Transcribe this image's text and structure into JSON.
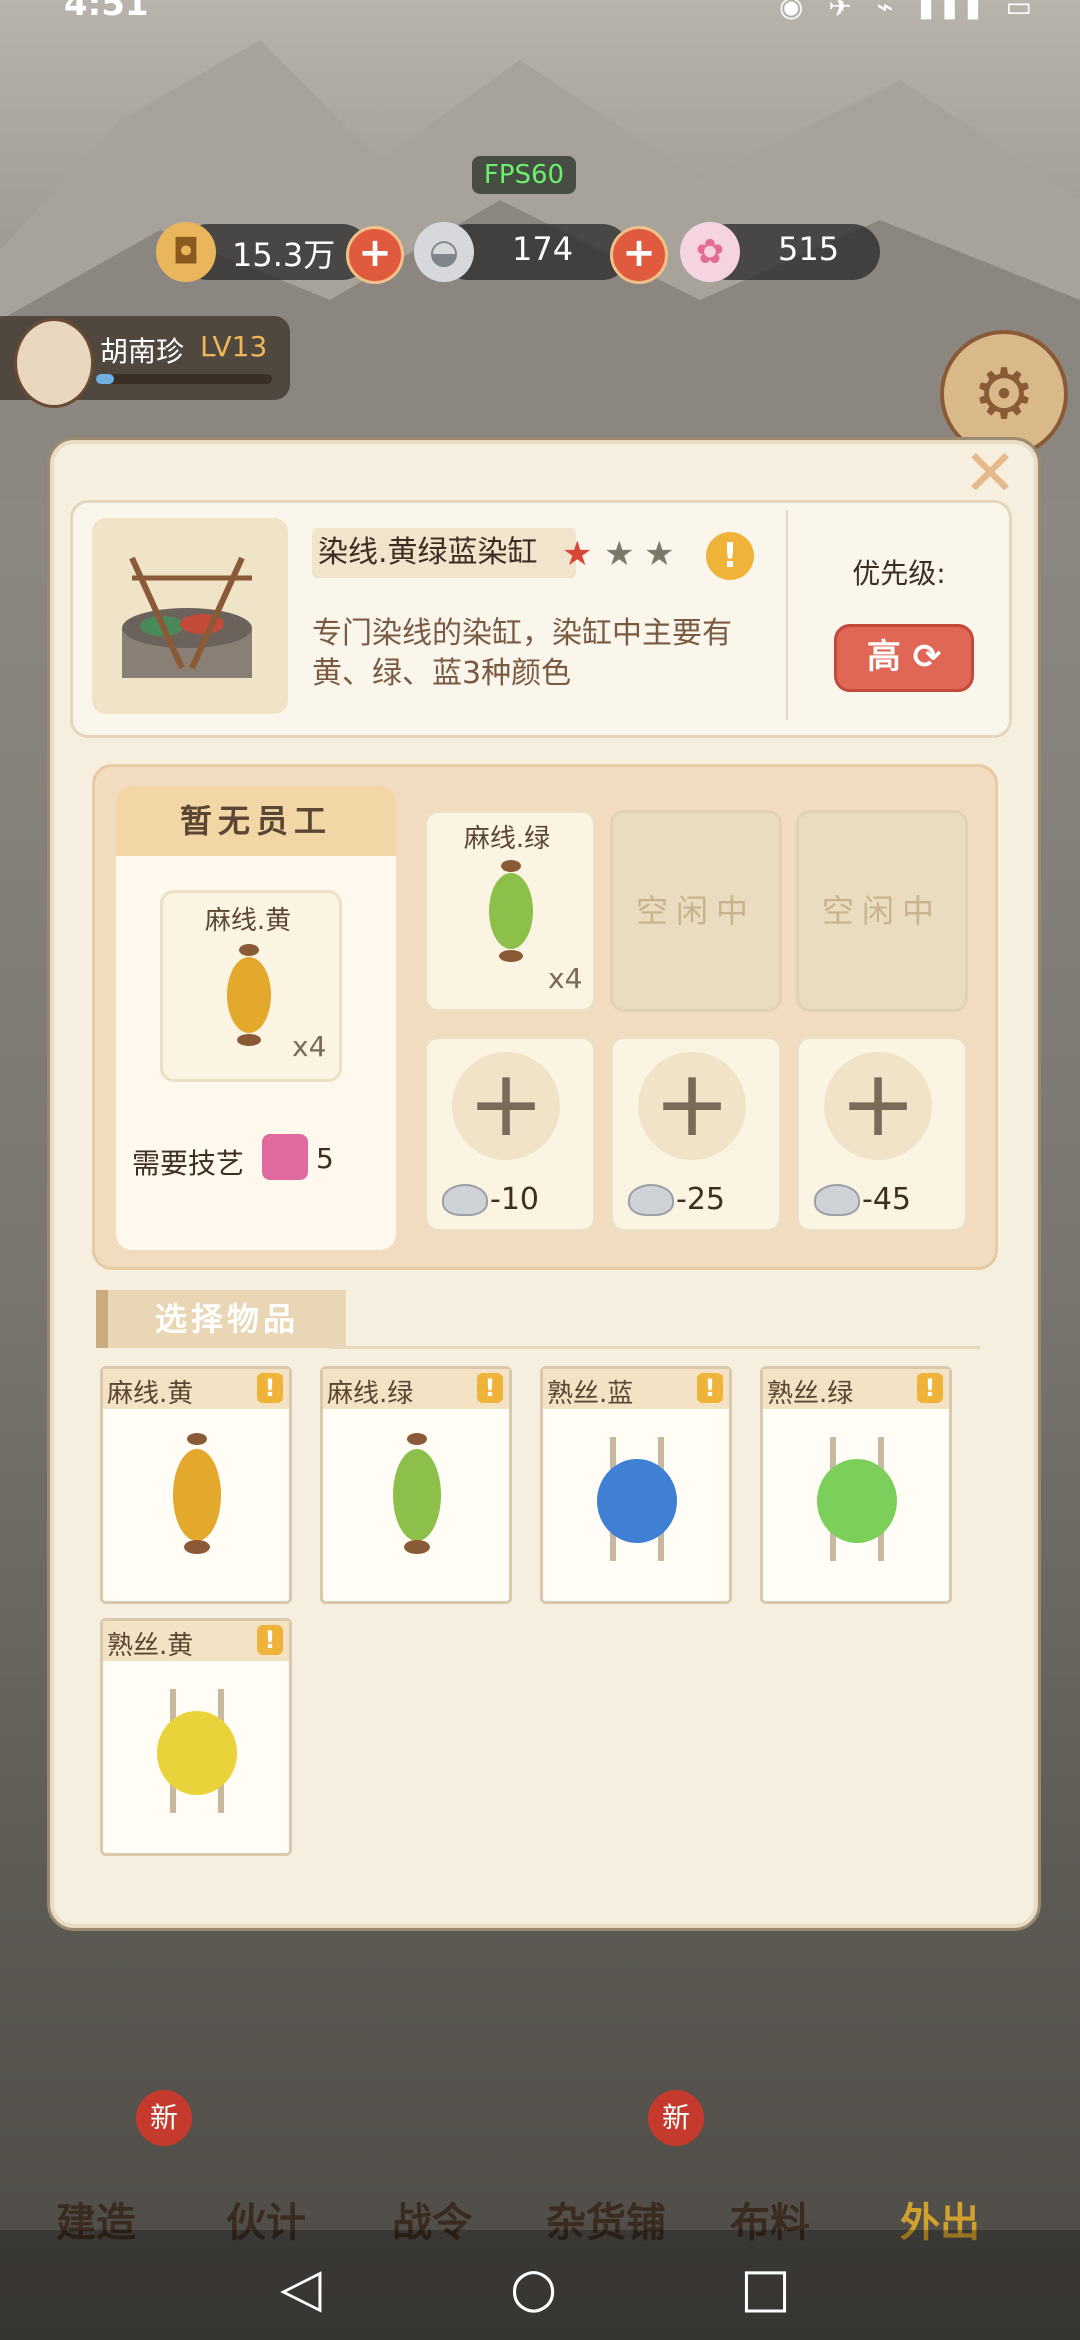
{
  "status": {
    "time": "4:51",
    "icons": "◉ ✈ ⌁ ▮▮▮ ▭"
  },
  "fps": "FPS60",
  "resources": [
    {
      "name": "copper-coin",
      "value": "15.3万"
    },
    {
      "name": "silver-ingot",
      "value": "174"
    },
    {
      "name": "flower",
      "value": "515"
    }
  ],
  "player": {
    "name": "胡南珍",
    "level": "LV13"
  },
  "building": {
    "name": "染线.黄绿蓝染缸",
    "stars": [
      "★",
      "★",
      "★"
    ],
    "description": "专门染线的染缸，染缸中主要有黄、绿、蓝3种颜色",
    "priority_label": "优先级:",
    "priority_value": "高"
  },
  "staff": {
    "title": "暂无员工",
    "current_item": "麻线.黄",
    "current_qty": "x4",
    "skill_label": "需要技艺",
    "skill_value": "5"
  },
  "queue": [
    {
      "label": "麻线.绿",
      "qty": "x4"
    },
    {
      "label": "空闲中"
    },
    {
      "label": "空闲中"
    }
  ],
  "unlock_costs": [
    "-10",
    "-25",
    "-45"
  ],
  "select_header": "选择物品",
  "items": [
    {
      "name": "麻线.黄",
      "color": "#e3a82c",
      "kind": "spool"
    },
    {
      "name": "麻线.绿",
      "color": "#8cc04a",
      "kind": "spool"
    },
    {
      "name": "熟丝.蓝",
      "color": "#3f7fd4",
      "kind": "silk"
    },
    {
      "name": "熟丝.绿",
      "color": "#7ccf5a",
      "kind": "silk"
    },
    {
      "name": "熟丝.黄",
      "color": "#ead23a",
      "kind": "silk"
    }
  ],
  "nav": [
    "建造",
    "伙计",
    "战令",
    "杂货铺",
    "布料",
    "外出"
  ],
  "badges": {
    "new": "新"
  }
}
